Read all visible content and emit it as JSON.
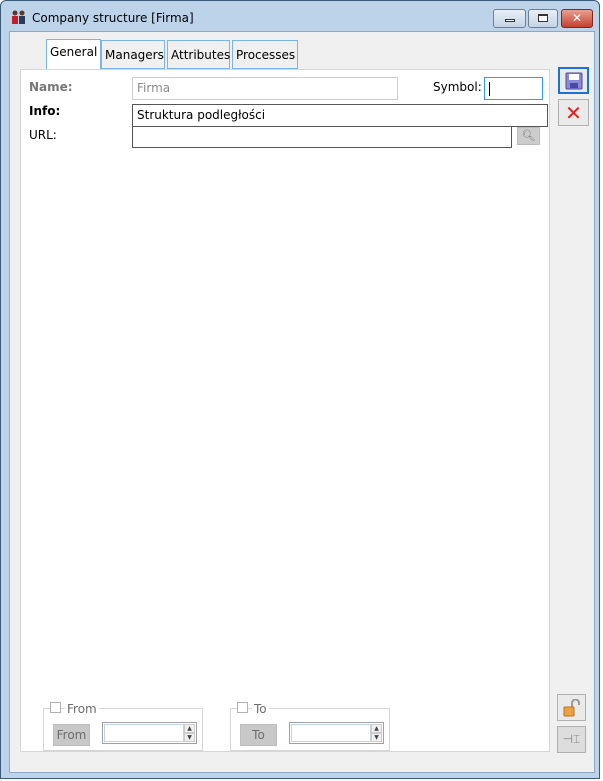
{
  "window": {
    "title": "Company structure [Firma]",
    "accent": "#3399ff"
  },
  "tabs": [
    {
      "label": "General",
      "active": true
    },
    {
      "label": "Managers"
    },
    {
      "label": "Attributes"
    },
    {
      "label": "Processes"
    }
  ],
  "form": {
    "name_label": "Name:",
    "name_value": "Firma",
    "symbol_label": "Symbol:",
    "symbol_value": "",
    "info_label": "Info:",
    "info_value": "Struktura podległości",
    "url_label": "URL:",
    "url_value": ""
  },
  "from_group": {
    "checkbox_label": "From",
    "button_label": "From",
    "value": ""
  },
  "to_group": {
    "checkbox_label": "To",
    "button_label": "To",
    "value": ""
  }
}
